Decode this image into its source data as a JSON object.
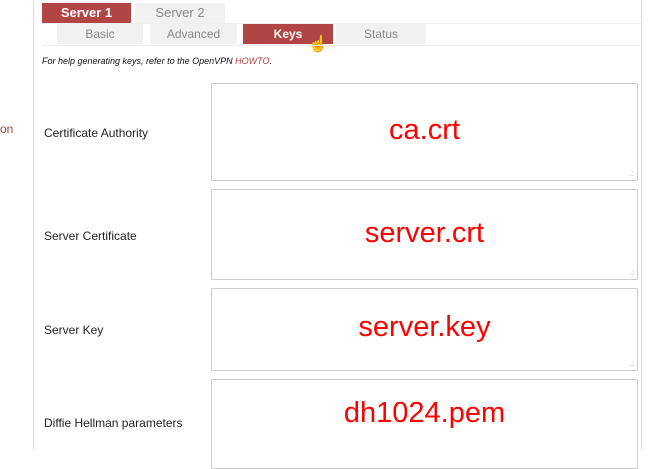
{
  "sidebar": {
    "partial_text": "on"
  },
  "server_tabs": [
    {
      "label": "Server 1",
      "active": true
    },
    {
      "label": "Server 2",
      "active": false
    }
  ],
  "sub_tabs": [
    {
      "label": "Basic"
    },
    {
      "label": "Advanced"
    },
    {
      "label": "Keys",
      "active": true
    },
    {
      "label": "Status"
    }
  ],
  "help": {
    "text": "For help generating keys, refer to the OpenVPN ",
    "link": "HOWTO",
    "end": "."
  },
  "fields": [
    {
      "label": "Certificate Authority",
      "value": "ca.crt"
    },
    {
      "label": "Server Certificate",
      "value": "server.crt"
    },
    {
      "label": "Server Key",
      "value": "server.key"
    },
    {
      "label": "Diffie Hellman parameters",
      "value": "dh1024.pem"
    }
  ],
  "colors": {
    "accent": "#b14444",
    "value": "#ff0000"
  }
}
